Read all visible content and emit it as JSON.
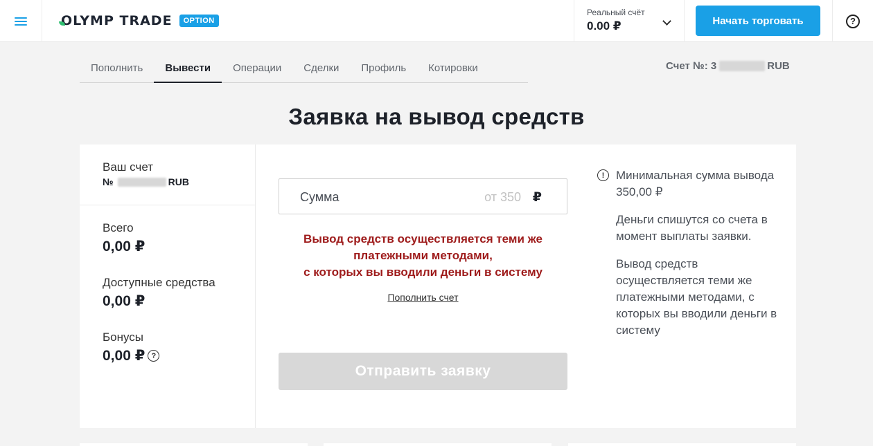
{
  "header": {
    "brand_name": "OLYMP TRADE",
    "brand_badge": "OPTION",
    "account": {
      "label": "Реальный счёт",
      "balance": "0.00 ₽"
    },
    "start_trading_label": "Начать торговать",
    "help_symbol": "?"
  },
  "tabs": [
    {
      "label": "Пополнить",
      "active": false
    },
    {
      "label": "Вывести",
      "active": true
    },
    {
      "label": "Операции",
      "active": false
    },
    {
      "label": "Сделки",
      "active": false
    },
    {
      "label": "Профиль",
      "active": false
    },
    {
      "label": "Котировки",
      "active": false
    }
  ],
  "account_number": {
    "prefix": "Счет №: 3",
    "suffix": "RUB"
  },
  "page_title": "Заявка на вывод средств",
  "left_panel": {
    "your_account_label": "Ваш счет",
    "number_prefix": "№",
    "number_suffix": "RUB",
    "stats": [
      {
        "label": "Всего",
        "value": "0,00 ₽"
      },
      {
        "label": "Доступные средства",
        "value": "0,00 ₽"
      },
      {
        "label": "Бонусы",
        "value": "0,00 ₽"
      }
    ],
    "bonus_help_symbol": "?"
  },
  "form": {
    "amount_label": "Сумма",
    "amount_placeholder": "от 350",
    "currency": "₽",
    "warning_lines": [
      "Вывод средств осуществляется теми же",
      "платежными методами,",
      "с которых вы вводили деньги в систему"
    ],
    "deposit_link": "Пополнить счет",
    "submit_label": "Отправить заявку"
  },
  "info": {
    "icon_symbol": "!",
    "paragraphs": [
      "Минимальная сумма вывода 350,00 ₽",
      "Деньги спишутся со счета в момент выплаты заявки.",
      "Вывод средств осуществляется теми же платежными методами, с которых вы вводили деньги в систему"
    ]
  },
  "colors": {
    "accent": "#1aa0e6",
    "warning": "#9e1b1b",
    "disabled_button": "#d8d8d8",
    "background": "#f3f3f3"
  }
}
